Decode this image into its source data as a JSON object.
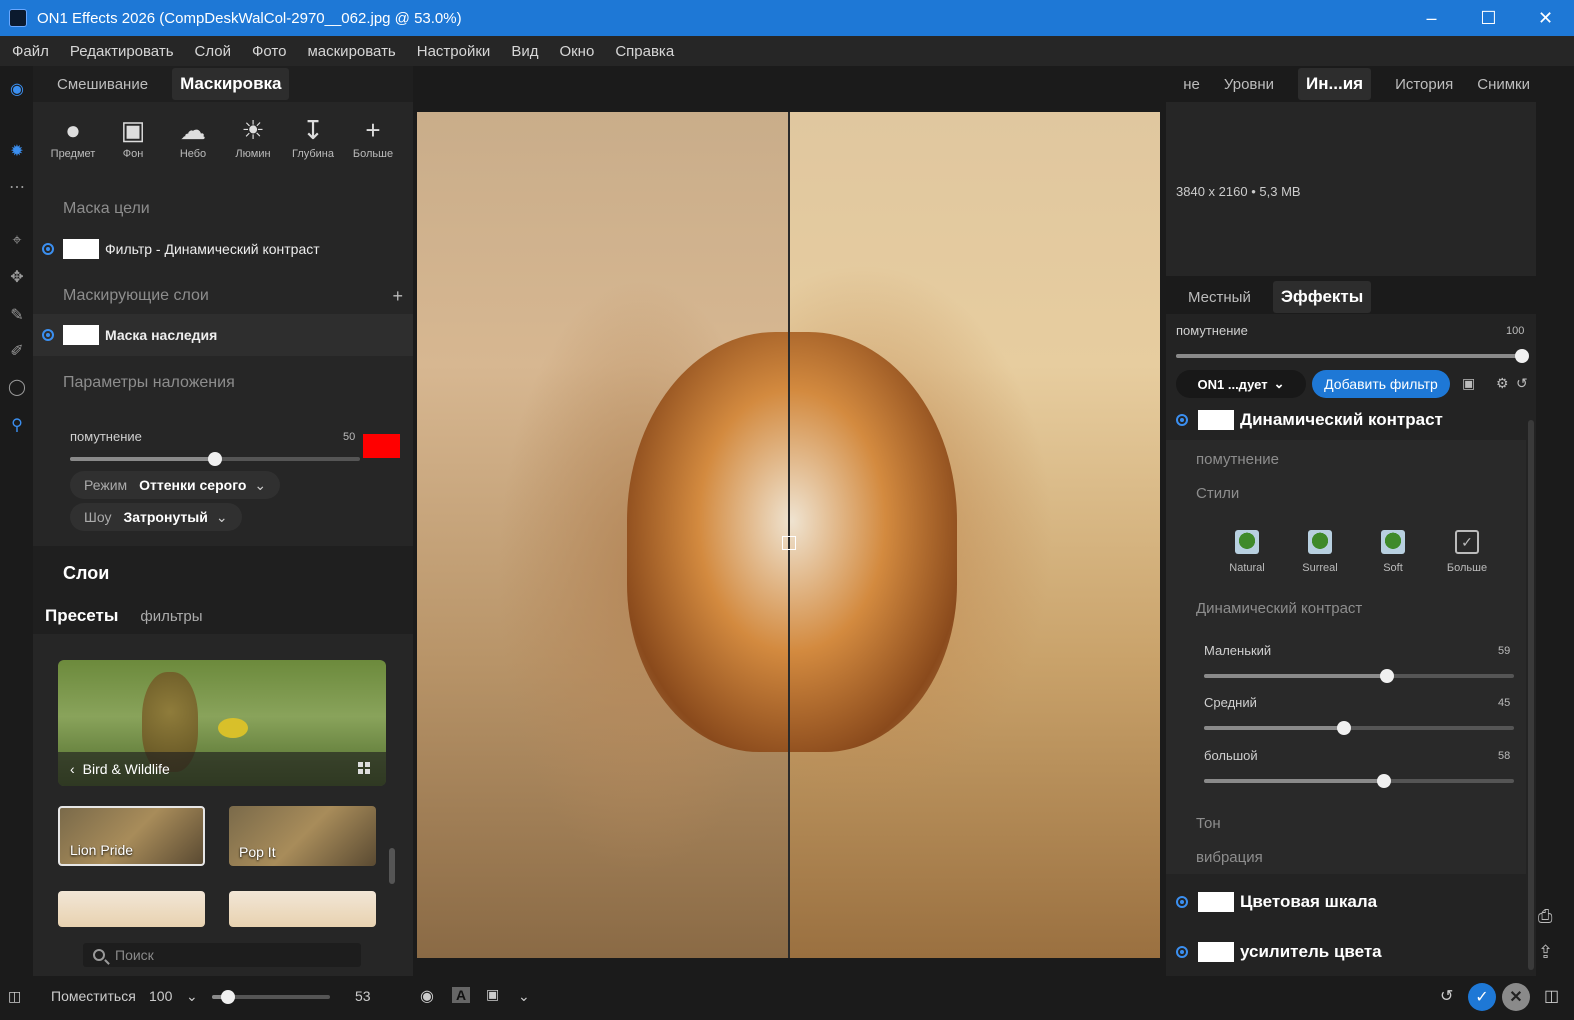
{
  "window": {
    "title": "ON1 Effects 2026 (CompDeskWalCol-2970__062.jpg @ 53.0%)",
    "minimize_icon": "minimize-icon",
    "maximize_icon": "maximize-icon",
    "close_icon": "close-icon"
  },
  "menu": [
    "Файл",
    "Редактировать",
    "Слой",
    "Фото",
    "маскировать",
    "Настройки",
    "Вид",
    "Окно",
    "Справка"
  ],
  "left_tabs": {
    "blend": "Смешивание",
    "masking": "Маскировка"
  },
  "mask_tools": [
    {
      "label": "Предмет",
      "glyph": "●"
    },
    {
      "label": "Фон",
      "glyph": "▣"
    },
    {
      "label": "Небо",
      "glyph": "☁"
    },
    {
      "label": "Люмин",
      "glyph": "☀"
    },
    {
      "label": "Глубина",
      "glyph": "↧"
    },
    {
      "label": "Больше",
      "glyph": "+"
    }
  ],
  "target_mask": {
    "heading": "Маска цели",
    "item": "Фильтр - Динамический контраст"
  },
  "mask_layers": {
    "heading": "Маскирующие слои",
    "item": "Маска наследия",
    "add": "+"
  },
  "blend_params": {
    "heading": "Параметры наложения",
    "opacity_label": "помутнение",
    "opacity_value": "50",
    "opacity": 50,
    "overlay_color": "#ff0000",
    "mode_label": "Режим",
    "mode_value": "Оттенки серого",
    "show_label": "Шоу",
    "show_value": "Затронутый"
  },
  "layers": {
    "title": "Слои"
  },
  "preset_tabs": {
    "presets": "Пресеты",
    "filters": "фильтры"
  },
  "featured_category": "Bird & Wildlife",
  "presets": [
    {
      "name": "Lion Pride"
    },
    {
      "name": "Pop It"
    }
  ],
  "search": {
    "placeholder": "Поиск"
  },
  "right_tabs": [
    "не",
    "Уровни",
    "Ин...ия",
    "История",
    "Снимки"
  ],
  "image_info": {
    "dims": "3840 x 2160",
    "separator": "•",
    "size": "5,3 MB"
  },
  "effects_tabs": {
    "local": "Местный",
    "effects": "Эффекты"
  },
  "effects": {
    "opacity_label": "помутнение",
    "opacity_value": "100",
    "opacity": 100,
    "preset_dropdown": "ON1 ...дует",
    "add_filter": "Добавить фильтр"
  },
  "filter_dynamic": {
    "title": "Динамический контраст",
    "opacity_section": "помутнение",
    "styles_section": "Стили",
    "styles": [
      "Natural",
      "Surreal",
      "Soft",
      "Больше"
    ],
    "contrast_section": "Динамический контраст",
    "small_label": "Маленький",
    "small_value": "59",
    "small": 59,
    "medium_label": "Средний",
    "medium_value": "45",
    "medium": 45,
    "large_label": "большой",
    "large_value": "58",
    "large": 58,
    "tone_section": "Тон",
    "vibrance_section": "вибрация"
  },
  "filter_colorscale": {
    "title": "Цветовая шкала"
  },
  "filter_colorboost": {
    "title": "усилитель цвета"
  },
  "bottom": {
    "fit_label": "Поместиться",
    "zoom_value": "100",
    "zoom_slider_value": "53",
    "zoom": 53
  },
  "colors": {
    "accent": "#1e78d6",
    "panel": "#262626",
    "background": "#1b1b1b"
  }
}
